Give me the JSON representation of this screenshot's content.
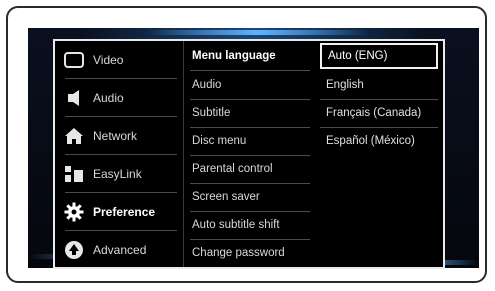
{
  "menu": {
    "categories": [
      {
        "label": "Video",
        "icon": "video-icon"
      },
      {
        "label": "Audio",
        "icon": "audio-icon"
      },
      {
        "label": "Network",
        "icon": "network-icon"
      },
      {
        "label": "EasyLink",
        "icon": "easylink-icon"
      },
      {
        "label": "Preference",
        "icon": "preference-gear-icon"
      },
      {
        "label": "Advanced",
        "icon": "advanced-icon"
      }
    ],
    "selected_category": "Preference",
    "options": [
      "Menu language",
      "Audio",
      "Subtitle",
      "Disc menu",
      "Parental control",
      "Screen saver",
      "Auto subtitle shift",
      "Change password"
    ],
    "selected_option": "Menu language",
    "values": [
      "Auto (ENG)",
      "English",
      "Français (Canada)",
      "Español (México)"
    ],
    "selected_value": "Auto (ENG)"
  },
  "colors": {
    "panel_bg": "#000000",
    "frame_border": "#eaeaea",
    "glow": "#5fb4ff"
  }
}
